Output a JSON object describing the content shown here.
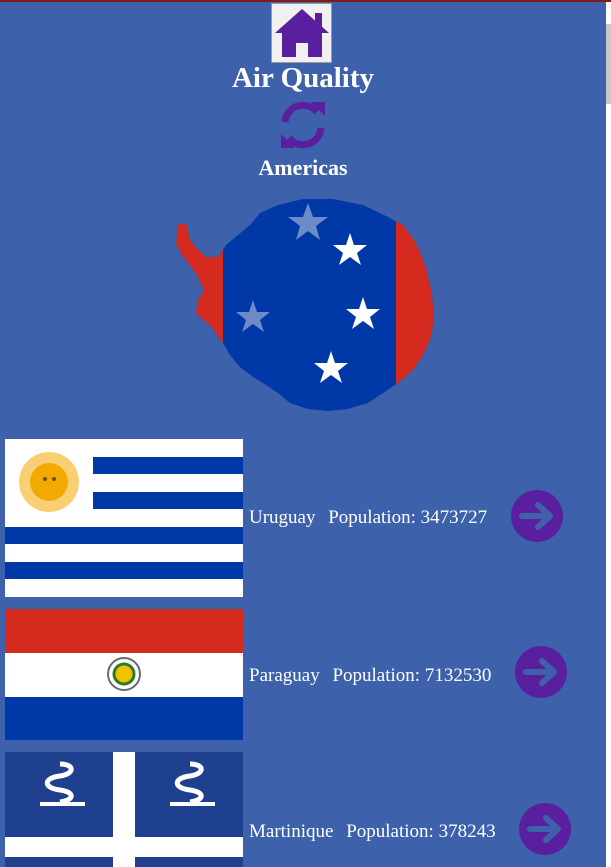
{
  "header": {
    "title": "Air Quality",
    "region": "Americas"
  },
  "colors": {
    "background": "#3d62ab",
    "icon_purple": "#5a1f9e",
    "flag_blue": "#0038a8",
    "flag_red": "#d52b1e"
  },
  "icons": {
    "home": "home-icon",
    "refresh": "refresh-icon",
    "arrow": "arrow-right-icon"
  },
  "countries": [
    {
      "name": "Uruguay",
      "population_label": "Population:",
      "population": "3473727"
    },
    {
      "name": "Paraguay",
      "population_label": "Population:",
      "population": "7132530"
    },
    {
      "name": "Martinique",
      "population_label": "Population:",
      "population": "378243"
    }
  ]
}
